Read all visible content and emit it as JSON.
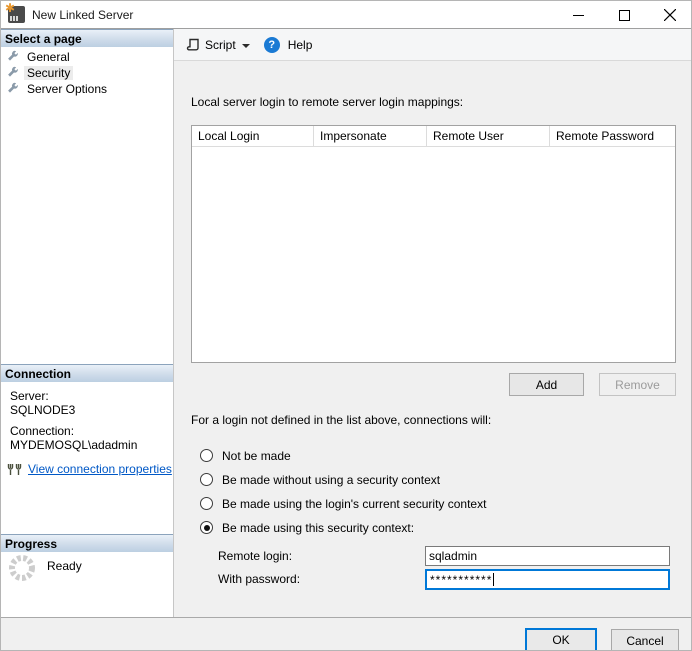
{
  "window": {
    "title": "New Linked Server"
  },
  "toolbar": {
    "script_label": "Script",
    "help_label": "Help"
  },
  "sidebar": {
    "select_page": {
      "header": "Select a page",
      "items": [
        {
          "label": "General",
          "selected": false
        },
        {
          "label": "Security",
          "selected": true
        },
        {
          "label": "Server Options",
          "selected": false
        }
      ]
    },
    "connection": {
      "header": "Connection",
      "server_label": "Server:",
      "server_value": "SQLNODE3",
      "connection_label": "Connection:",
      "connection_value": "MYDEMOSQL\\adadmin",
      "link": "View connection properties"
    },
    "progress": {
      "header": "Progress",
      "status": "Ready"
    }
  },
  "main": {
    "mappings_label": "Local server login to remote server login mappings:",
    "table": {
      "columns": [
        "Local Login",
        "Impersonate",
        "Remote User",
        "Remote Password"
      ],
      "rows": []
    },
    "add_button": "Add",
    "remove_button": "Remove",
    "fallback_label": "For a login not defined in the list above, connections will:",
    "radio_options": [
      {
        "label": "Not be made",
        "selected": false
      },
      {
        "label": "Be made without using a security context",
        "selected": false
      },
      {
        "label": "Be made using the login's current security context",
        "selected": false
      },
      {
        "label": "Be made using this security context:",
        "selected": true
      }
    ],
    "remote_login_label": "Remote login:",
    "remote_login_value": "sqladmin",
    "password_label": "With password:",
    "password_value": "***********"
  },
  "footer": {
    "ok": "OK",
    "cancel": "Cancel"
  },
  "colors": {
    "accent": "#0078d7",
    "link": "#0058c6",
    "section_header_top": "#e9f0f8",
    "section_header_bottom": "#bccfe2",
    "icon_star": "#e8972e",
    "help_icon": "#1a7ad4"
  }
}
